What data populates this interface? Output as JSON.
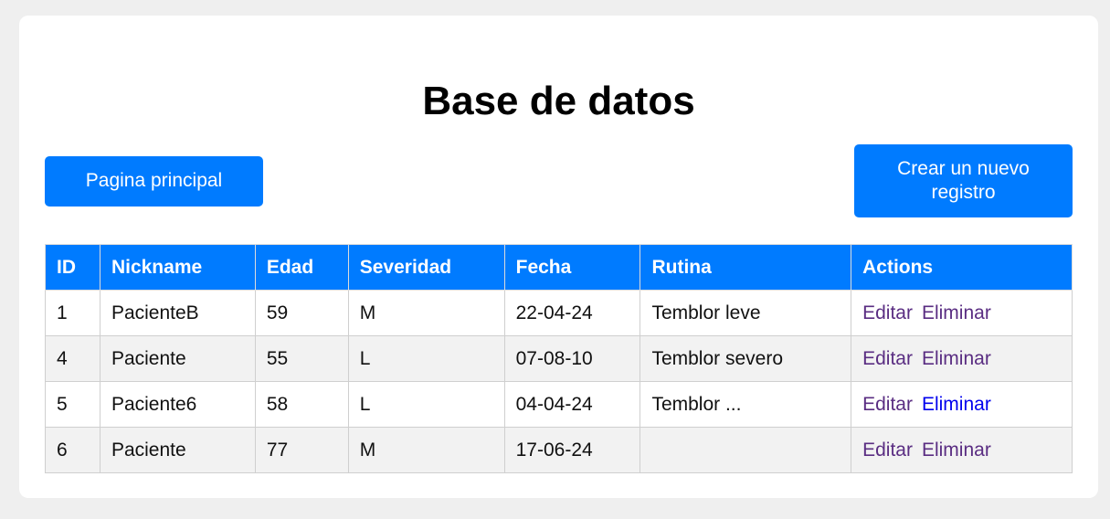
{
  "page": {
    "title": "Base de datos"
  },
  "buttons": {
    "main_page": "Pagina principal",
    "new_record": "Crear un nuevo registro"
  },
  "table": {
    "headers": [
      "ID",
      "Nickname",
      "Edad",
      "Severidad",
      "Fecha",
      "Rutina",
      "Actions"
    ],
    "rows": [
      {
        "id": "1",
        "nickname": "PacienteB",
        "edad": "59",
        "severidad": "M",
        "fecha": "22-04-24",
        "rutina": "Temblor leve"
      },
      {
        "id": "4",
        "nickname": "Paciente",
        "edad": "55",
        "severidad": "L",
        "fecha": "07-08-10",
        "rutina": "Temblor severo"
      },
      {
        "id": "5",
        "nickname": "Paciente6",
        "edad": "58",
        "severidad": "L",
        "fecha": "04-04-24",
        "rutina": "Temblor ..."
      },
      {
        "id": "6",
        "nickname": "Paciente",
        "edad": "77",
        "severidad": "M",
        "fecha": "17-06-24",
        "rutina": ""
      }
    ],
    "actions": {
      "edit_label": "Editar",
      "delete_label": "Eliminar"
    }
  },
  "colors": {
    "accent": "#007bff",
    "visited_link": "#5a2d82",
    "link": "#0000ee",
    "background": "#efefef"
  }
}
